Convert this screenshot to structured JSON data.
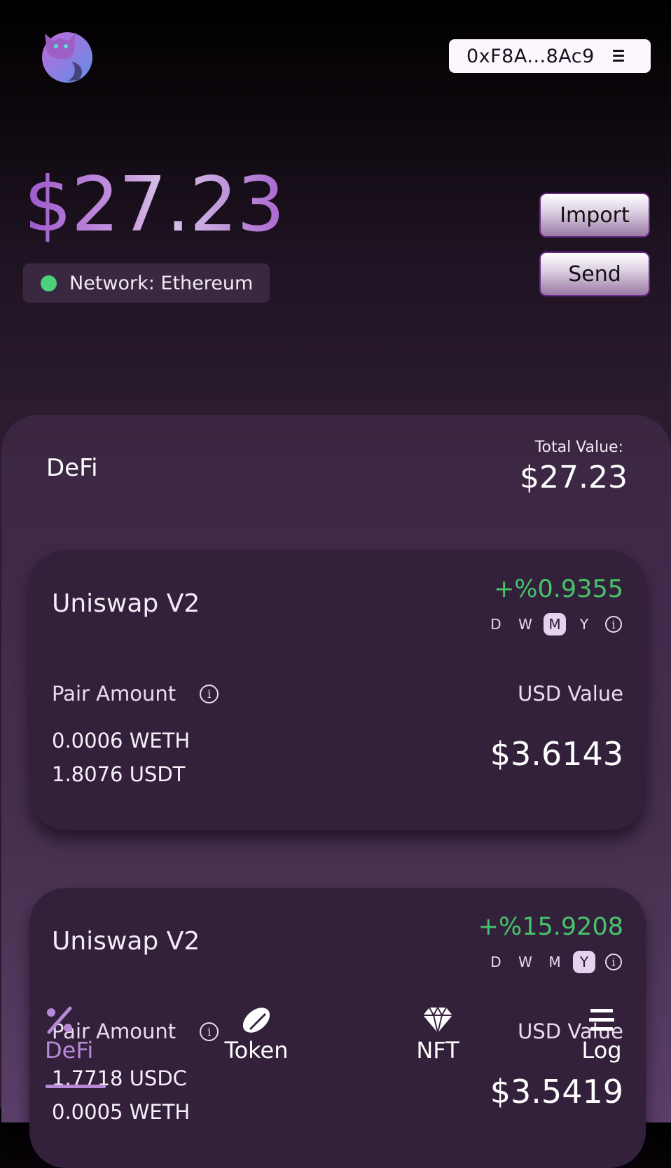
{
  "header": {
    "wallet_address": "0xF8A...8Ac9",
    "balance": "$27.23",
    "network_label": "Network: Ethereum",
    "import_label": "Import",
    "send_label": "Send"
  },
  "defi": {
    "title": "DeFi",
    "total_value_label": "Total Value:",
    "total_value": "$27.23"
  },
  "positions": [
    {
      "name": "Uniswap V2",
      "change": "+%0.9355",
      "periods": [
        "D",
        "W",
        "M",
        "Y"
      ],
      "active_period": "M",
      "pair_amount_label": "Pair Amount",
      "usd_value_label": "USD Value",
      "amounts": [
        "0.0006 WETH",
        "1.8076 USDT"
      ],
      "usd_value": "$3.6143"
    },
    {
      "name": "Uniswap V2",
      "change": "+%15.9208",
      "periods": [
        "D",
        "W",
        "M",
        "Y"
      ],
      "active_period": "Y",
      "pair_amount_label": "Pair Amount",
      "usd_value_label": "USD Value",
      "amounts": [
        "1.7718 USDC",
        "0.0005 WETH"
      ],
      "usd_value": "$3.5419"
    }
  ],
  "bottom_nav": {
    "items": [
      {
        "label": "DeFi",
        "icon": "percent-icon",
        "active": true
      },
      {
        "label": "Token",
        "icon": "coin-icon",
        "active": false
      },
      {
        "label": "NFT",
        "icon": "diamond-icon",
        "active": false
      },
      {
        "label": "Log",
        "icon": "list-icon",
        "active": false
      }
    ]
  },
  "colors": {
    "accent": "#b78ad8",
    "positive": "#46c46a",
    "network_dot": "#4cd07a"
  }
}
